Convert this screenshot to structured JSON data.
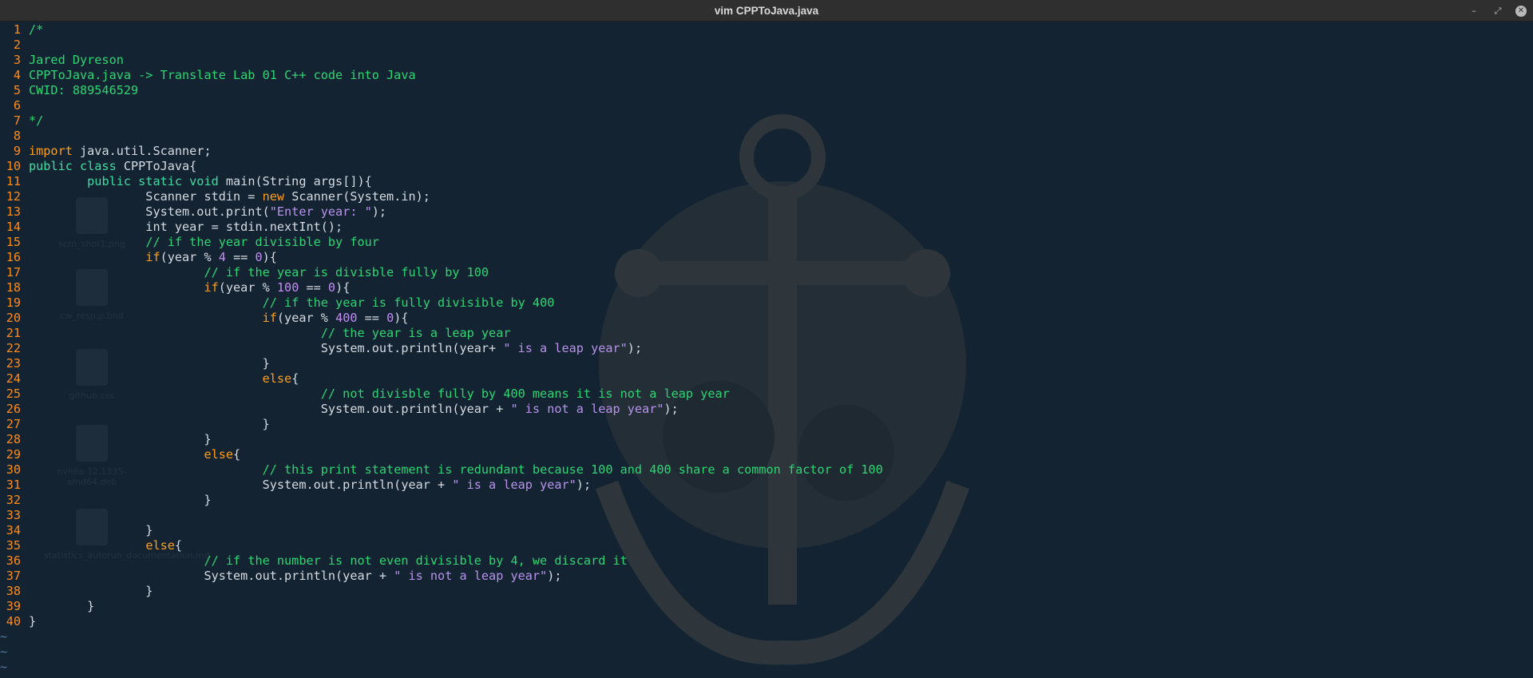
{
  "window": {
    "title": "vim CPPToJava.java",
    "controls": [
      {
        "name": "minimize-button",
        "glyph": "–"
      },
      {
        "name": "maximize-button",
        "glyph": "⤢"
      },
      {
        "name": "close-button",
        "glyph": "✕"
      }
    ]
  },
  "desktop_icons": [
    {
      "name": "desktop-icon-screenshot",
      "label": "scrn_shot1.png"
    },
    {
      "name": "desktop-icon-file",
      "label": "cw_resp.p.bnd"
    },
    {
      "name": "desktop-icon-css",
      "label": "github.css"
    },
    {
      "name": "desktop-icon-deb",
      "label": "nvidia-12.1335-amd64.deb"
    },
    {
      "name": "desktop-icon-md",
      "label": "statistics_autorun_documentation.md"
    }
  ],
  "editor": {
    "lines": [
      {
        "n": "1",
        "tokens": [
          {
            "t": "/*",
            "c": "cmt"
          }
        ]
      },
      {
        "n": "2",
        "tokens": []
      },
      {
        "n": "3",
        "tokens": [
          {
            "t": "Jared Dyreson",
            "c": "cmt"
          }
        ]
      },
      {
        "n": "4",
        "tokens": [
          {
            "t": "CPPToJava.java -> Translate Lab 01 C++ code into Java",
            "c": "cmt"
          }
        ]
      },
      {
        "n": "5",
        "tokens": [
          {
            "t": "CWID: 889546529",
            "c": "cmt"
          }
        ]
      },
      {
        "n": "6",
        "tokens": []
      },
      {
        "n": "7",
        "tokens": [
          {
            "t": "*/",
            "c": "cmt"
          }
        ]
      },
      {
        "n": "8",
        "tokens": []
      },
      {
        "n": "9",
        "tokens": [
          {
            "t": "import",
            "c": "kw"
          },
          {
            "t": " java.util.Scanner;",
            "c": "txt"
          }
        ]
      },
      {
        "n": "10",
        "tokens": [
          {
            "t": "public class",
            "c": "type"
          },
          {
            "t": " CPPToJava{",
            "c": "txt"
          }
        ]
      },
      {
        "n": "11",
        "tokens": [
          {
            "t": "        ",
            "c": "txt"
          },
          {
            "t": "public static void",
            "c": "type"
          },
          {
            "t": " main(String args[]){",
            "c": "txt"
          }
        ]
      },
      {
        "n": "12",
        "tokens": [
          {
            "t": "                Scanner stdin = ",
            "c": "txt"
          },
          {
            "t": "new",
            "c": "kw"
          },
          {
            "t": " Scanner(System.in);",
            "c": "txt"
          }
        ]
      },
      {
        "n": "13",
        "tokens": [
          {
            "t": "                System.out.print(",
            "c": "txt"
          },
          {
            "t": "\"Enter year: \"",
            "c": "str"
          },
          {
            "t": ");",
            "c": "txt"
          }
        ]
      },
      {
        "n": "14",
        "tokens": [
          {
            "t": "                int year = stdin.nextInt();",
            "c": "txt"
          }
        ]
      },
      {
        "n": "15",
        "tokens": [
          {
            "t": "                ",
            "c": "txt"
          },
          {
            "t": "// if the year divisible by four",
            "c": "cmt"
          }
        ]
      },
      {
        "n": "16",
        "tokens": [
          {
            "t": "                ",
            "c": "txt"
          },
          {
            "t": "if",
            "c": "kw"
          },
          {
            "t": "(year % ",
            "c": "txt"
          },
          {
            "t": "4",
            "c": "num"
          },
          {
            "t": " == ",
            "c": "txt"
          },
          {
            "t": "0",
            "c": "num"
          },
          {
            "t": "){",
            "c": "txt"
          }
        ]
      },
      {
        "n": "17",
        "tokens": [
          {
            "t": "                        ",
            "c": "txt"
          },
          {
            "t": "// if the year is divisble fully by 100",
            "c": "cmt"
          }
        ]
      },
      {
        "n": "18",
        "tokens": [
          {
            "t": "                        ",
            "c": "txt"
          },
          {
            "t": "if",
            "c": "kw"
          },
          {
            "t": "(year % ",
            "c": "txt"
          },
          {
            "t": "100",
            "c": "num"
          },
          {
            "t": " == ",
            "c": "txt"
          },
          {
            "t": "0",
            "c": "num"
          },
          {
            "t": "){",
            "c": "txt"
          }
        ]
      },
      {
        "n": "19",
        "tokens": [
          {
            "t": "                                ",
            "c": "txt"
          },
          {
            "t": "// if the year is fully divisible by 400",
            "c": "cmt"
          }
        ]
      },
      {
        "n": "20",
        "tokens": [
          {
            "t": "                                ",
            "c": "txt"
          },
          {
            "t": "if",
            "c": "kw"
          },
          {
            "t": "(year % ",
            "c": "txt"
          },
          {
            "t": "400",
            "c": "num"
          },
          {
            "t": " == ",
            "c": "txt"
          },
          {
            "t": "0",
            "c": "num"
          },
          {
            "t": "){",
            "c": "txt"
          }
        ]
      },
      {
        "n": "21",
        "tokens": [
          {
            "t": "                                        ",
            "c": "txt"
          },
          {
            "t": "// the year is a leap year",
            "c": "cmt"
          }
        ]
      },
      {
        "n": "22",
        "tokens": [
          {
            "t": "                                        System.out.println(year+ ",
            "c": "txt"
          },
          {
            "t": "\" is a leap year\"",
            "c": "str"
          },
          {
            "t": ");",
            "c": "txt"
          }
        ]
      },
      {
        "n": "23",
        "tokens": [
          {
            "t": "                                }",
            "c": "txt"
          }
        ]
      },
      {
        "n": "24",
        "tokens": [
          {
            "t": "                                ",
            "c": "txt"
          },
          {
            "t": "else",
            "c": "kw"
          },
          {
            "t": "{",
            "c": "txt"
          }
        ]
      },
      {
        "n": "25",
        "tokens": [
          {
            "t": "                                        ",
            "c": "txt"
          },
          {
            "t": "// not divisble fully by 400 means it is not a leap year",
            "c": "cmt"
          }
        ]
      },
      {
        "n": "26",
        "tokens": [
          {
            "t": "                                        System.out.println(year + ",
            "c": "txt"
          },
          {
            "t": "\" is not a leap year\"",
            "c": "str"
          },
          {
            "t": ");",
            "c": "txt"
          }
        ]
      },
      {
        "n": "27",
        "tokens": [
          {
            "t": "                                }",
            "c": "txt"
          }
        ]
      },
      {
        "n": "28",
        "tokens": [
          {
            "t": "                        }",
            "c": "txt"
          }
        ]
      },
      {
        "n": "29",
        "tokens": [
          {
            "t": "                        ",
            "c": "txt"
          },
          {
            "t": "else",
            "c": "kw"
          },
          {
            "t": "{",
            "c": "txt"
          }
        ]
      },
      {
        "n": "30",
        "tokens": [
          {
            "t": "                                ",
            "c": "txt"
          },
          {
            "t": "// this print statement is redundant because 100 and 400 share a common factor of 100",
            "c": "cmt"
          }
        ]
      },
      {
        "n": "31",
        "tokens": [
          {
            "t": "                                System.out.println(year + ",
            "c": "txt"
          },
          {
            "t": "\" is a leap year\"",
            "c": "str"
          },
          {
            "t": ");",
            "c": "txt"
          }
        ]
      },
      {
        "n": "32",
        "tokens": [
          {
            "t": "                        }",
            "c": "txt"
          }
        ]
      },
      {
        "n": "33",
        "tokens": []
      },
      {
        "n": "34",
        "tokens": [
          {
            "t": "                }",
            "c": "txt"
          }
        ]
      },
      {
        "n": "35",
        "tokens": [
          {
            "t": "                ",
            "c": "txt"
          },
          {
            "t": "else",
            "c": "kw"
          },
          {
            "t": "{",
            "c": "txt"
          }
        ]
      },
      {
        "n": "36",
        "tokens": [
          {
            "t": "                        ",
            "c": "txt"
          },
          {
            "t": "// if the number is not even divisible by 4, we discard it",
            "c": "cmt"
          }
        ]
      },
      {
        "n": "37",
        "tokens": [
          {
            "t": "                        System.out.println(year + ",
            "c": "txt"
          },
          {
            "t": "\" is not a leap year\"",
            "c": "str"
          },
          {
            "t": ");",
            "c": "txt"
          }
        ]
      },
      {
        "n": "38",
        "tokens": [
          {
            "t": "                }",
            "c": "txt"
          }
        ]
      },
      {
        "n": "39",
        "tokens": [
          {
            "t": "        }",
            "c": "txt"
          }
        ]
      },
      {
        "n": "40",
        "tokens": [
          {
            "t": "}",
            "c": "txt"
          }
        ]
      }
    ],
    "filler": [
      "~",
      "~",
      "~"
    ]
  }
}
